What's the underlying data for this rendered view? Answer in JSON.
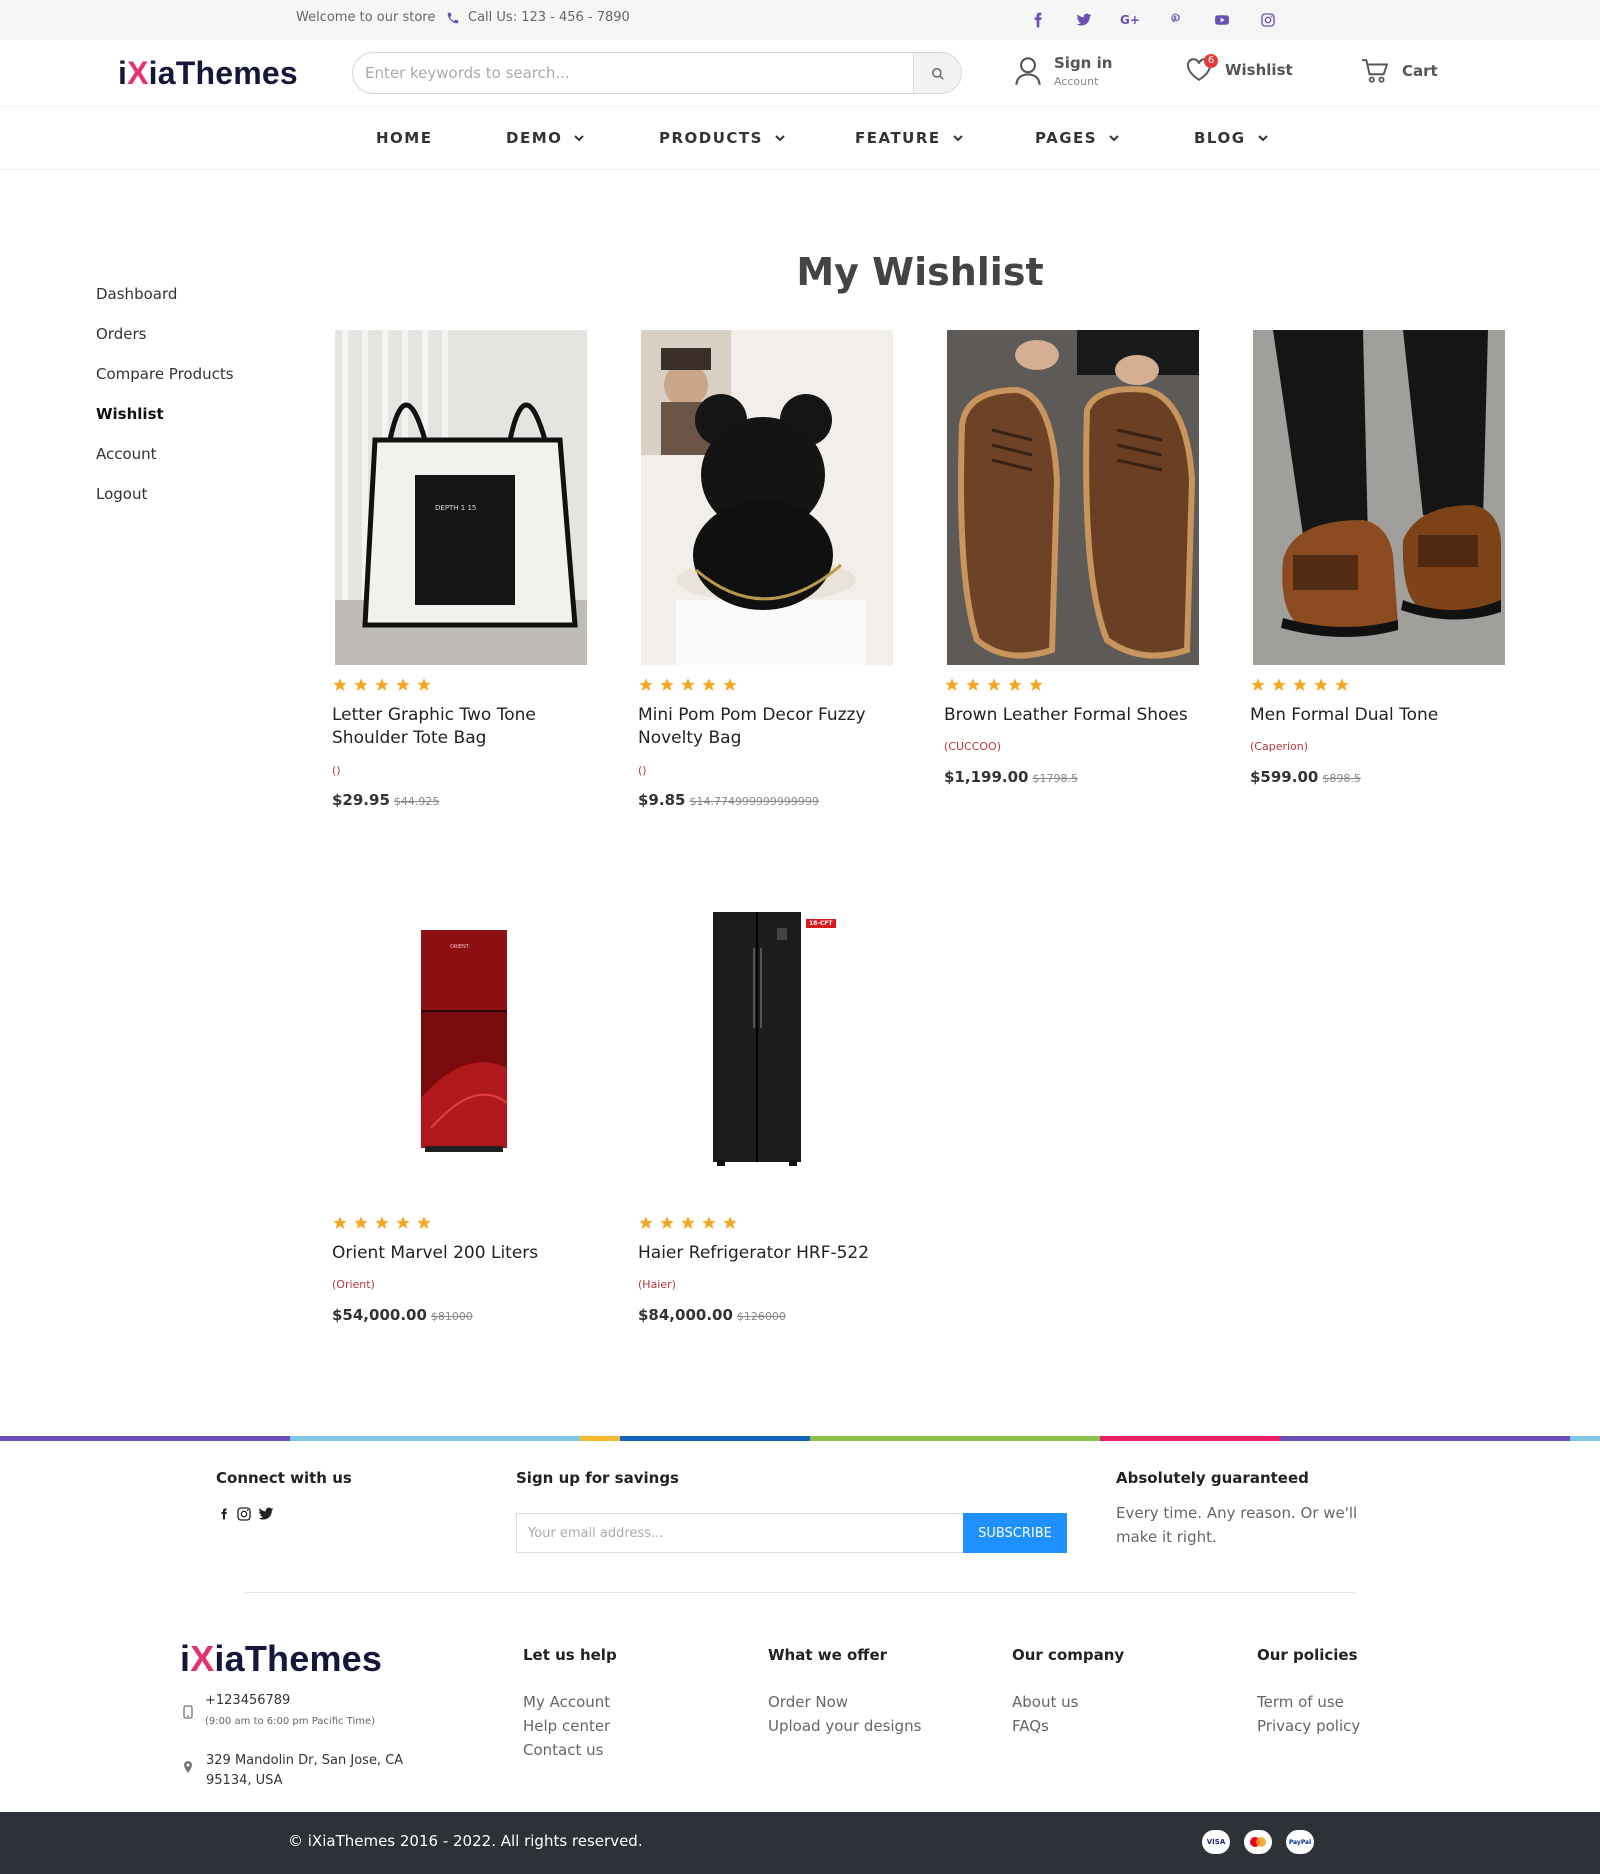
{
  "topbar": {
    "welcome": "Welcome to our store",
    "phone": "Call Us: 123 - 456 - 7890",
    "socials": [
      "facebook-icon",
      "twitter-icon",
      "google-plus-icon",
      "pinterest-icon",
      "youtube-icon",
      "instagram-icon"
    ]
  },
  "header": {
    "logo_prefix": "i",
    "logo_x": "X",
    "logo_suffix": "iaThemes",
    "search_placeholder": "Enter keywords to search...",
    "signin_label": "Sign in",
    "signin_sub": "Account",
    "wishlist_label": "Wishlist",
    "wishlist_count": "6",
    "cart_label": "Cart"
  },
  "nav": {
    "items": [
      {
        "label": "HOME"
      },
      {
        "label": "DEMO"
      },
      {
        "label": "PRODUCTS"
      },
      {
        "label": "FEATURE"
      },
      {
        "label": "PAGES"
      },
      {
        "label": "BLOG"
      }
    ]
  },
  "sidebar": {
    "items": [
      {
        "label": "Dashboard"
      },
      {
        "label": "Orders"
      },
      {
        "label": "Compare Products"
      },
      {
        "label": "Wishlist",
        "active": true
      },
      {
        "label": "Account"
      },
      {
        "label": "Logout"
      }
    ]
  },
  "main": {
    "title": "My Wishlist",
    "products": [
      {
        "title_l1": "Letter Graphic Two Tone",
        "title_l2": "Shoulder Tote Bag",
        "brand": "()",
        "price": "$29.95",
        "old_price": "$44.925",
        "rating": 5
      },
      {
        "title_l1": "Mini Pom Pom Decor Fuzzy",
        "title_l2": "Novelty Bag",
        "brand": "()",
        "price": "$9.85",
        "old_price": "$14.774999999999999",
        "rating": 5
      },
      {
        "title_l1": "Brown Leather Formal Shoes",
        "title_l2": "",
        "brand": "(CUCCOO)",
        "price": "$1,199.00",
        "old_price": "$1798.5",
        "rating": 5
      },
      {
        "title_l1": "Men Formal Dual Tone",
        "title_l2": "",
        "brand": "(Caperion)",
        "price": "$599.00",
        "old_price": "$898.5",
        "rating": 5
      },
      {
        "title_l1": "Orient Marvel 200 Liters",
        "title_l2": "",
        "brand": "(Orient)",
        "price": "$54,000.00",
        "old_price": "$81000",
        "rating": 5
      },
      {
        "title_l1": "Haier Refrigerator HRF-522",
        "title_l2": "",
        "brand": "(Haier)",
        "price": "$84,000.00",
        "old_price": "$126000",
        "rating": 5,
        "tag": "18-CFT"
      }
    ]
  },
  "footer": {
    "connect_heading": "Connect with us",
    "signup_heading": "Sign up for savings",
    "email_placeholder": "Your email address...",
    "subscribe_label": "SUBSCRIBE",
    "guarantee_heading": "Absolutely guaranteed",
    "guarantee_l1": "Every time. Any reason. Or we'll",
    "guarantee_l2": "make it right.",
    "phone": "+123456789",
    "hours": "(9:00 am to 6:00 pm Pacific Time)",
    "address_l1": "329 Mandolin Dr, San Jose, CA",
    "address_l2": "95134, USA",
    "columns": [
      {
        "heading": "Let us help",
        "links": [
          "My Account",
          "Help center",
          "Contact us"
        ]
      },
      {
        "heading": "What we offer",
        "links": [
          "Order Now",
          "Upload your designs"
        ]
      },
      {
        "heading": "Our company",
        "links": [
          "About us",
          "FAQs"
        ]
      },
      {
        "heading": "Our policies",
        "links": [
          "Term of use",
          "Privacy policy"
        ]
      }
    ],
    "copyright": "© iXiaThemes 2016 - 2022. All rights reserved.",
    "payments": [
      "VISA",
      "mastercard",
      "PayPal"
    ]
  },
  "colors": {
    "accent": "#6a4fb6",
    "logo_x": "#e2336b",
    "star": "#f5a623",
    "subscribe": "#1e90ff",
    "bottom_bar": "#2c3238"
  }
}
